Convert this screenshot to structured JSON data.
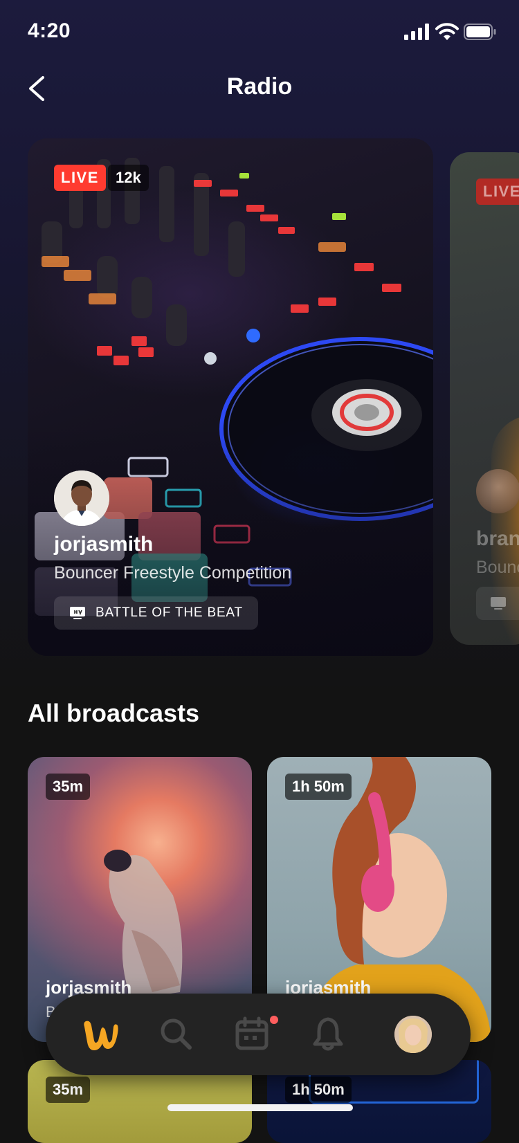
{
  "status_bar": {
    "time": "4:20"
  },
  "header": {
    "title": "Radio"
  },
  "featured": [
    {
      "live_label": "LIVE",
      "viewers": "12k",
      "user": "jorjasmith",
      "title": "Bouncer Freestyle Competition",
      "show": "BATTLE OF THE BEAT"
    },
    {
      "live_label": "LIVE",
      "user": "bran",
      "title": "Bounc"
    }
  ],
  "section": {
    "title": "All broadcasts"
  },
  "broadcasts": [
    {
      "duration": "35m",
      "user": "jorjasmith",
      "subtitle": "B"
    },
    {
      "duration": "1h 50m",
      "user": "jorjasmith"
    },
    {
      "duration": "35m"
    },
    {
      "duration": "1h 50m"
    }
  ],
  "nav": {
    "items": [
      "home-icon",
      "search-icon",
      "calendar-icon",
      "bell-icon",
      "profile-avatar"
    ],
    "active": "home-icon",
    "accent": "#f5a623"
  },
  "colors": {
    "live": "#ff3b30",
    "background": "#131313",
    "header_bg": "#1c1b3d"
  }
}
